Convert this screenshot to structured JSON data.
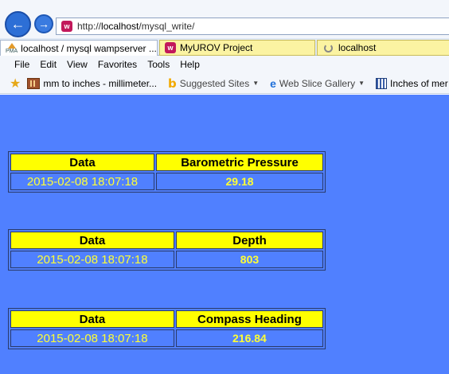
{
  "browser": {
    "address": {
      "prefix": "http://",
      "host": "localhost",
      "path": "/mysql_write/"
    },
    "tabs": [
      {
        "label": "localhost / mysql wampserver ...",
        "icon": "phpmyadmin-icon"
      },
      {
        "label": "MyUROV Project",
        "icon": "wamp-icon"
      },
      {
        "label": "localhost",
        "icon": "loading-spinner-icon"
      }
    ],
    "pma_icon_text": "PMA",
    "menu": [
      "File",
      "Edit",
      "View",
      "Favorites",
      "Tools",
      "Help"
    ],
    "favorites": [
      {
        "label": "mm to inches - millimeter...",
        "icon": "ruler-icon"
      },
      {
        "label": "Suggested Sites",
        "icon": "bing-icon"
      },
      {
        "label": "Web Slice Gallery",
        "icon": "ie-icon"
      },
      {
        "label": "Inches of mer",
        "icon": "grid-icon"
      }
    ]
  },
  "colors": {
    "page_background": "#5080ff",
    "header_cell": "#ffff00",
    "value_text": "#ffff33"
  },
  "tables": [
    {
      "headers": [
        "Data",
        "Barometric Pressure"
      ],
      "row": [
        "2015-02-08 18:07:18",
        "29.18"
      ]
    },
    {
      "headers": [
        "Data",
        "Depth"
      ],
      "row": [
        "2015-02-08 18:07:18",
        "803"
      ]
    },
    {
      "headers": [
        "Data",
        "Compass Heading"
      ],
      "row": [
        "2015-02-08 18:07:18",
        "216.84"
      ]
    }
  ]
}
